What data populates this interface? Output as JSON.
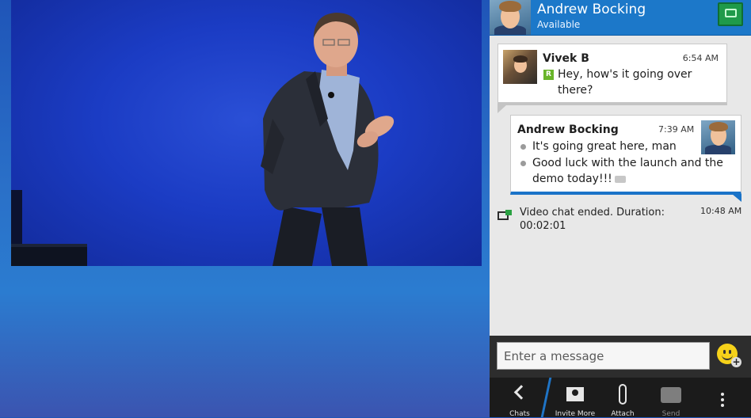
{
  "video": {
    "state": "playing"
  },
  "contact": {
    "name": "Andrew Bocking",
    "status": "Available"
  },
  "messages": [
    {
      "sender": "Vivek B",
      "time": "6:54 AM",
      "status_flag": "R",
      "text": "Hey, how's it going over there?"
    },
    {
      "sender": "Andrew Bocking",
      "time": "7:39 AM",
      "lines": [
        "It's going great here, man",
        "Good luck with the launch and the demo today!!!"
      ]
    }
  ],
  "system": {
    "text": "Video chat ended. Duration: 00:02:01",
    "time": "10:48 AM"
  },
  "input": {
    "placeholder": "Enter a message"
  },
  "actions": {
    "chats": "Chats",
    "invite_more": "Invite More",
    "attach": "Attach",
    "send": "Send"
  },
  "colors": {
    "header_blue": "#1c78c9",
    "accent_green": "#1f9a4a",
    "panel_bg": "#e8e8e8",
    "action_bar": "#1b1b1b"
  },
  "icons": [
    "video-chat-icon",
    "chevron-left-icon",
    "contact-add-icon",
    "paperclip-icon",
    "bbm-icon",
    "overflow-menu-icon",
    "emoji-icon"
  ]
}
